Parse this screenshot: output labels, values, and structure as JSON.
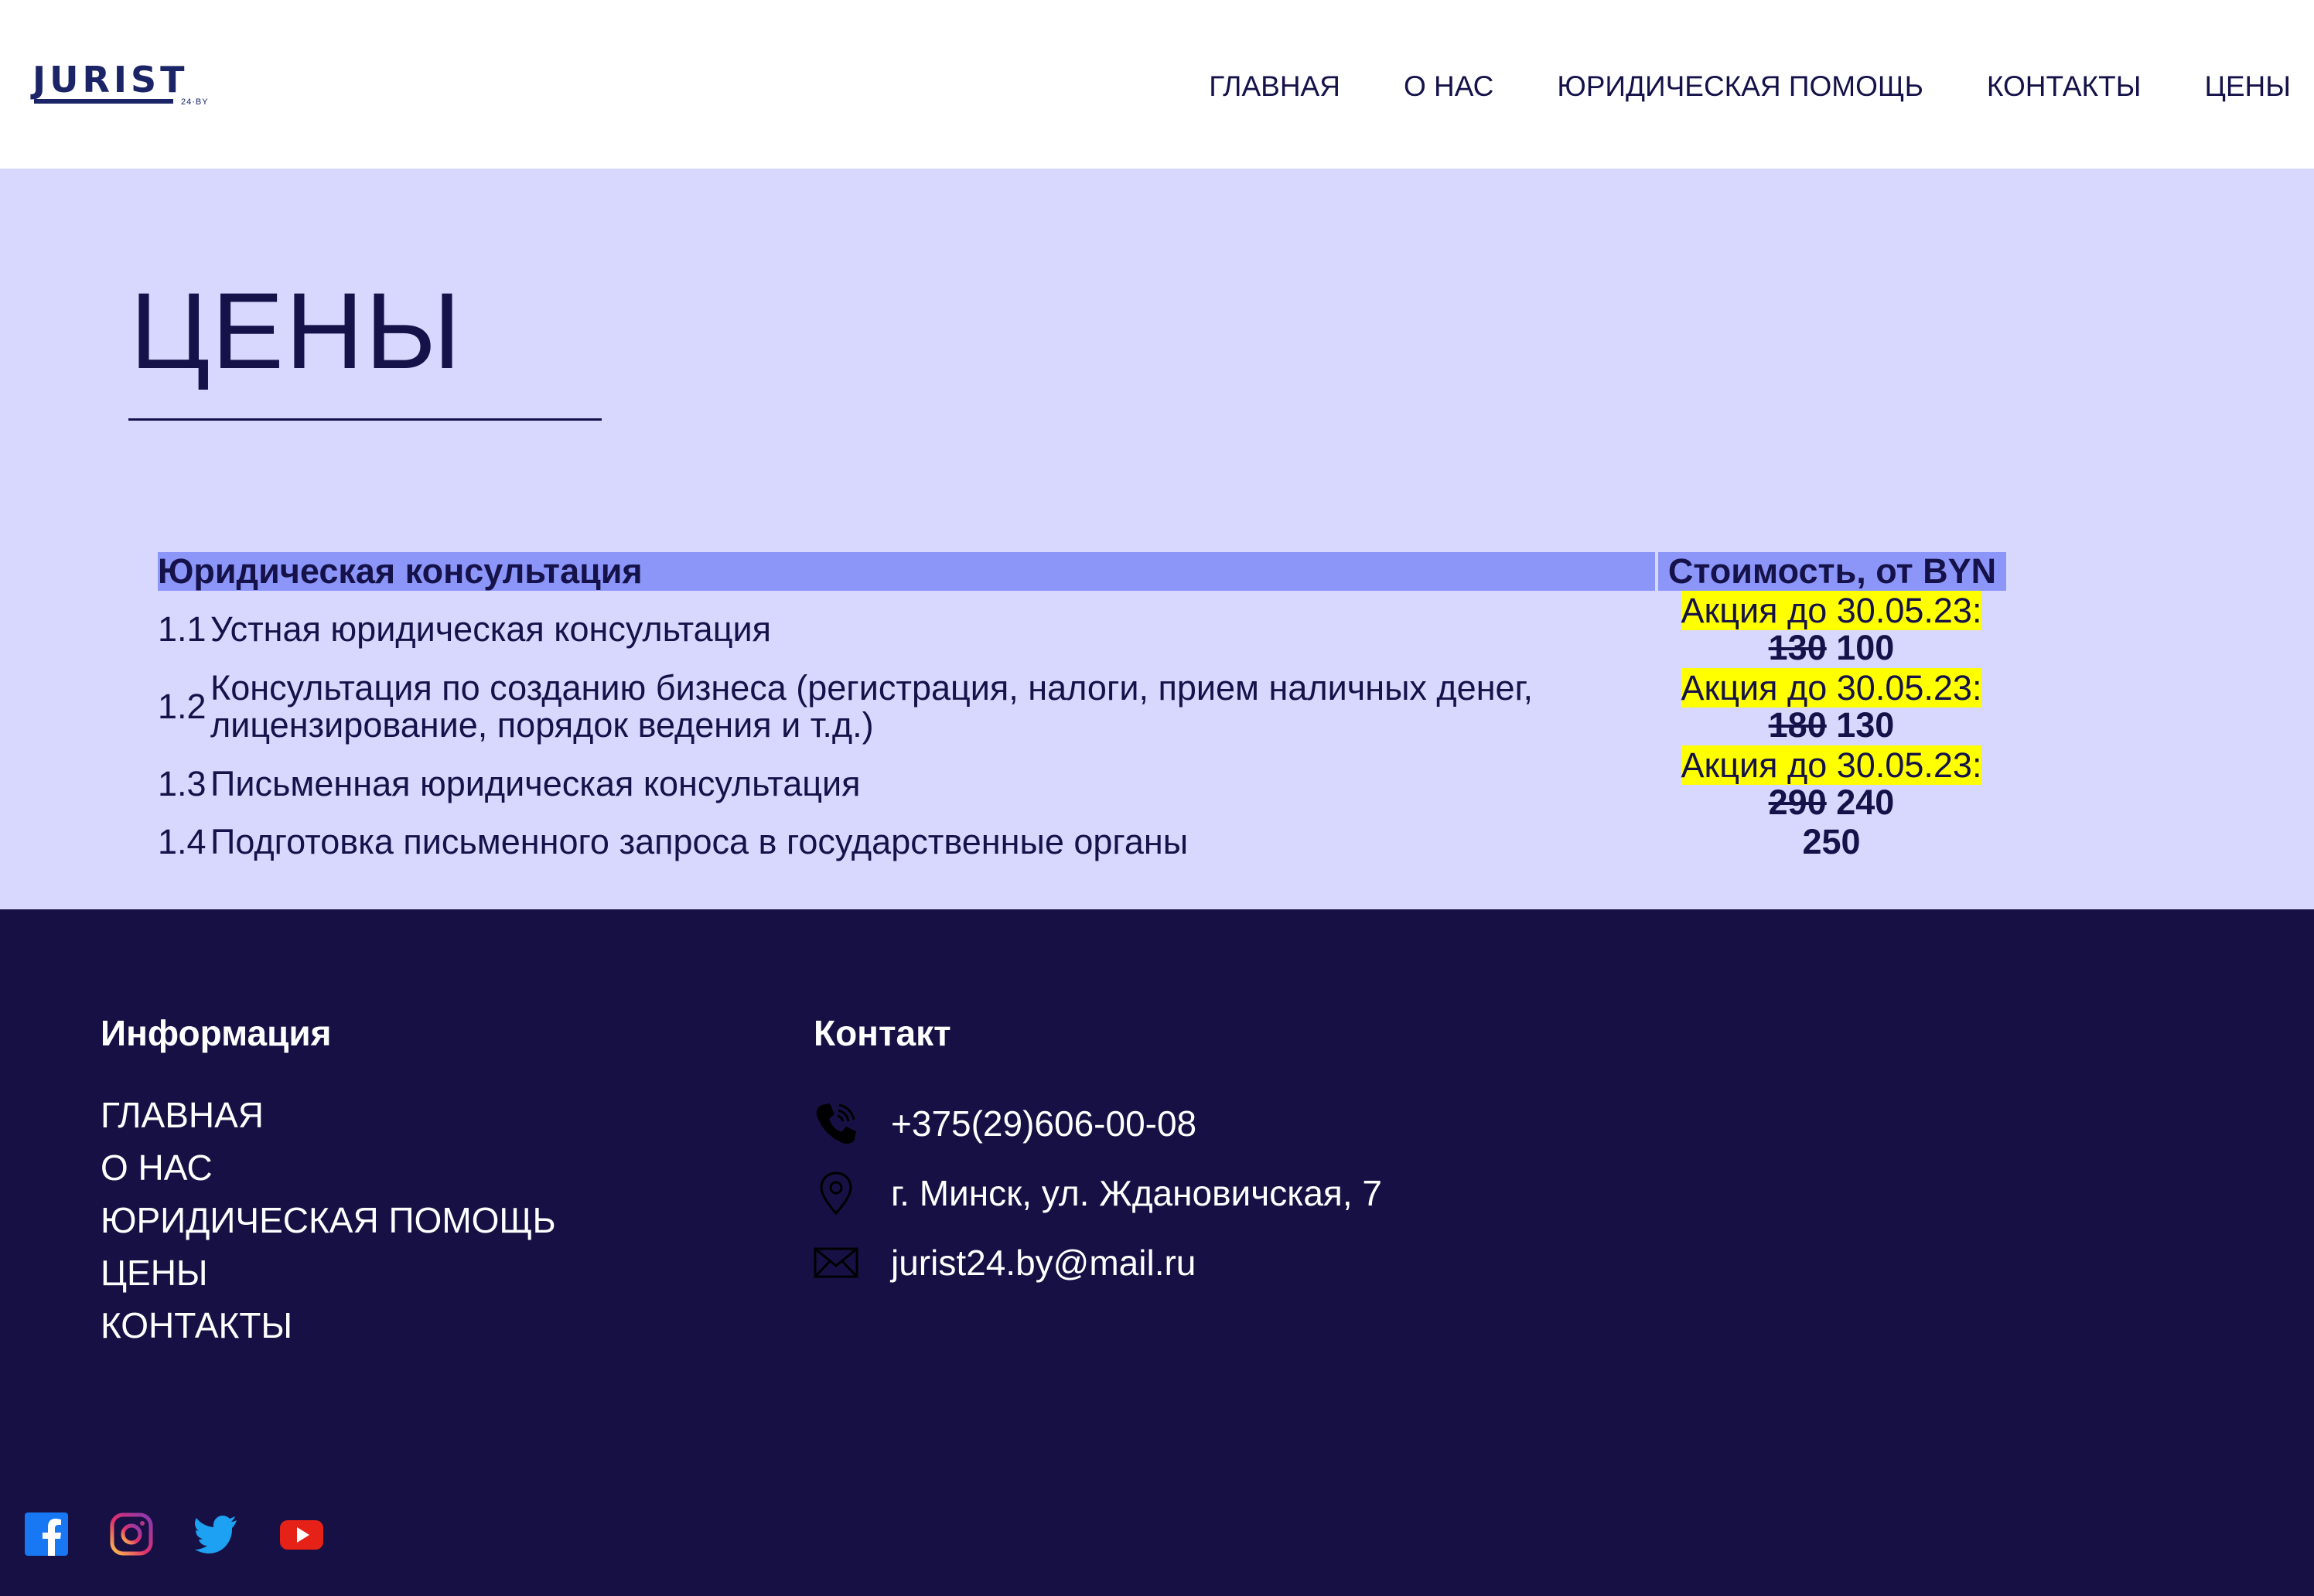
{
  "header": {
    "logo_text": "JURIST",
    "logo_sub": "24·BY",
    "nav": [
      {
        "label": "ГЛАВНАЯ"
      },
      {
        "label": "О НАС"
      },
      {
        "label": "ЮРИДИЧЕСКАЯ ПОМОЩЬ"
      },
      {
        "label": "КОНТАКТЫ"
      },
      {
        "label": "ЦЕНЫ"
      }
    ]
  },
  "main": {
    "title": "ЦЕНЫ",
    "table": {
      "header_service": "Юридическая консультация",
      "header_price": "Стоимость, от BYN",
      "rows": [
        {
          "num": "1.1",
          "service": "Устная юридическая консультация",
          "promo": "Акция до 30.05.23:",
          "old_price": "130",
          "price": "100"
        },
        {
          "num": "1.2",
          "service": "Консультация по созданию бизнеса (регистрация, налоги, прием наличных денег, лицензирование, порядок ведения и т.д.)",
          "promo": "Акция до 30.05.23:",
          "old_price": "180",
          "price": "130"
        },
        {
          "num": "1.3",
          "service": "Письменная юридическая консультация",
          "promo": "Акция до 30.05.23:",
          "old_price": "290",
          "price": "240"
        },
        {
          "num": "1.4",
          "service": "Подготовка письменного запроса в государственные органы",
          "price": "250"
        }
      ]
    },
    "colors": {
      "background": "#d8d7fe",
      "table_header": "#8c96f8",
      "promo_highlight": "#ffff00",
      "text": "#15124a"
    }
  },
  "footer": {
    "info_heading": "Информация",
    "links": [
      {
        "label": "ГЛАВНАЯ"
      },
      {
        "label": "О НАС"
      },
      {
        "label": "ЮРИДИЧЕСКАЯ ПОМОЩЬ"
      },
      {
        "label": "ЦЕНЫ"
      },
      {
        "label": "КОНТАКТЫ"
      }
    ],
    "contact_heading": "Контакт",
    "contacts": [
      {
        "icon": "phone-icon",
        "text": "+375(29)606-00-08"
      },
      {
        "icon": "location-pin-icon",
        "text": "г. Минск, ул. Ждановичская, 7"
      },
      {
        "icon": "envelope-icon",
        "text": "jurist24.by@mail.ru"
      }
    ],
    "socials": [
      {
        "icon": "facebook-icon"
      },
      {
        "icon": "instagram-icon"
      },
      {
        "icon": "twitter-icon"
      },
      {
        "icon": "youtube-icon"
      }
    ],
    "colors": {
      "background": "#171044"
    }
  }
}
